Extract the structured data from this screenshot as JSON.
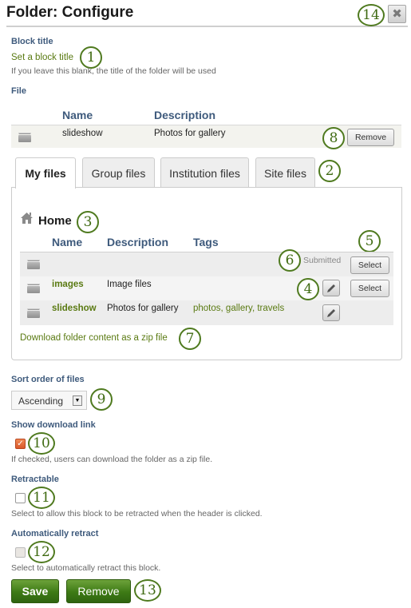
{
  "header": {
    "title": "Folder: Configure",
    "close_icon": "close-x-icon"
  },
  "block_title": {
    "label": "Block title",
    "link": "Set a block title",
    "help": "If you leave this blank, the title of the folder will be used"
  },
  "file": {
    "label": "File",
    "columns": [
      "Name",
      "Description"
    ],
    "rows": [
      {
        "icon": "folder-icon",
        "name": "slideshow",
        "description": "Photos for gallery",
        "action": "Remove"
      }
    ]
  },
  "tabs": [
    {
      "label": "My files",
      "active": true
    },
    {
      "label": "Group files",
      "active": false
    },
    {
      "label": "Institution files",
      "active": false
    },
    {
      "label": "Site files",
      "active": false
    }
  ],
  "browser": {
    "home_icon": "home-icon",
    "home_label": "Home",
    "columns": [
      "Name",
      "Description",
      "Tags"
    ],
    "rows": [
      {
        "icon": "folder-icon",
        "name": "",
        "description": "",
        "tags": "",
        "status": "Submitted",
        "editable": false,
        "action": "Select"
      },
      {
        "icon": "folder-icon",
        "name": "images",
        "description": "Image files",
        "tags": "",
        "status": "",
        "editable": true,
        "action": "Select"
      },
      {
        "icon": "folder-icon",
        "name": "slideshow",
        "description": "Photos for gallery",
        "tags": "photos, gallery, travels",
        "status": "",
        "editable": true,
        "action": ""
      }
    ],
    "download_link": "Download folder content as a zip file"
  },
  "sort_order": {
    "label": "Sort order of files",
    "selected": "Ascending"
  },
  "show_download": {
    "label": "Show download link",
    "checked": true,
    "help": "If checked, users can download the folder as a zip file."
  },
  "retractable": {
    "label": "Retractable",
    "checked": false,
    "help": "Select to allow this block to be retracted when the header is clicked."
  },
  "auto_retract": {
    "label": "Automatically retract",
    "checked": false,
    "disabled": true,
    "help": "Select to automatically retract this block."
  },
  "actions": {
    "save": "Save",
    "remove": "Remove"
  },
  "callouts": [
    "1",
    "2",
    "3",
    "4",
    "5",
    "6",
    "7",
    "8",
    "9",
    "10",
    "11",
    "12",
    "13",
    "14"
  ],
  "colors": {
    "label": "#3e5a7c",
    "link": "#5a7a12",
    "button_green": "#3d7a15",
    "checkbox_checked": "#d9582a",
    "callout": "#4f7a1f"
  }
}
